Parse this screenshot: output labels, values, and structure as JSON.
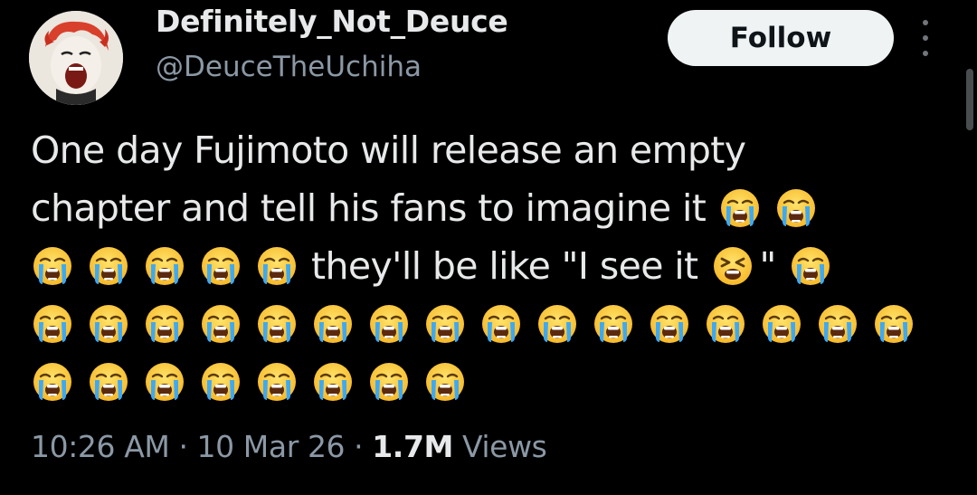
{
  "author": {
    "display_name": "Definitely_Not_Deuce",
    "handle": "@DeuceTheUchiha"
  },
  "actions": {
    "follow_label": "Follow"
  },
  "tweet": {
    "line1_text": "One day Fujimoto will release an empty",
    "line2_text": "chapter and tell his fans to imagine it",
    "line3_text": "they'll be like \"I see it",
    "line3_quote_close": "\"",
    "emoji_sequence": {
      "line2": [
        "loudly-crying-face",
        "loudly-crying-face"
      ],
      "line3_before": [
        "loudly-crying-face",
        "loudly-crying-face",
        "loudly-crying-face",
        "loudly-crying-face",
        "loudly-crying-face"
      ],
      "line3_inline": "tired-face",
      "line3_after": [
        "loudly-crying-face"
      ],
      "line4_count": 16,
      "line5_count": 8
    }
  },
  "meta": {
    "time": "10:26 AM",
    "separator": "·",
    "date": "10 Mar 26",
    "views_count": "1.7M",
    "views_label": "Views"
  },
  "colors": {
    "background": "#000000",
    "text_primary": "#e7e9ea",
    "text_secondary": "#8b98a5",
    "follow_bg": "#eff3f4",
    "follow_text": "#0f1419"
  }
}
